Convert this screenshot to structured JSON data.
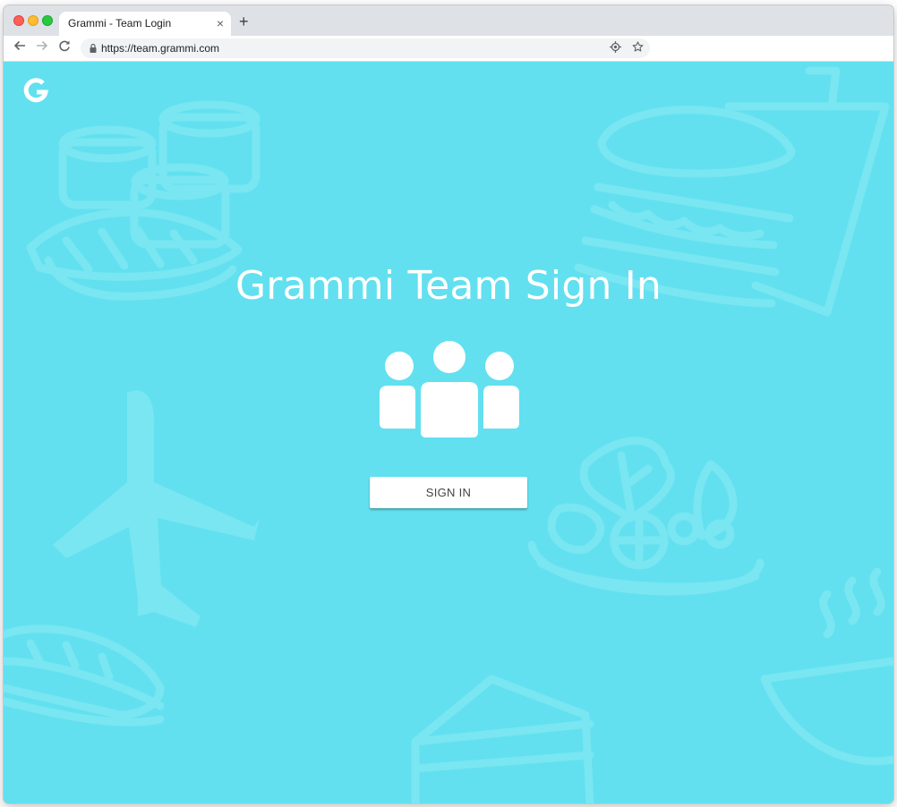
{
  "browser": {
    "tab_title": "Grammi - Team Login",
    "tab_close": "×",
    "new_tab": "+",
    "url": "https://team.grammi.com",
    "icons": {
      "back": "arrow-left-icon",
      "forward": "arrow-right-icon",
      "reload": "reload-icon",
      "lock": "lock-icon",
      "location": "location-icon",
      "bookmark": "star-icon"
    }
  },
  "page": {
    "logo_letter": "G",
    "title": "Grammi Team Sign In",
    "team_icon": "team-icon",
    "sign_in_label": "SIGN IN",
    "colors": {
      "background": "#62e0ef",
      "pattern": "#79e6f2",
      "text": "#ffffff",
      "button_bg": "#ffffff",
      "button_text": "#444444"
    }
  }
}
